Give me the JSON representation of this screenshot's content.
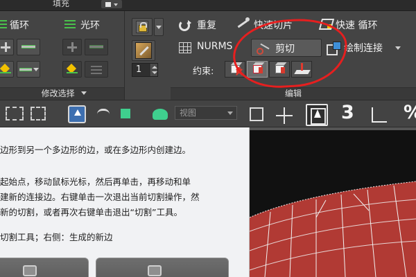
{
  "ribbon": {
    "tab_fill": "填充",
    "left_panel": {
      "loop_label": "循环",
      "ring_label": "光环",
      "spinner_value": "1",
      "footer": "修改选择"
    },
    "edit_panel": {
      "repeat_label": "重复",
      "nurms_label": "NURMS",
      "constraint_label": "约束:",
      "quickslice_label": "快速切片",
      "cut_label": "剪切",
      "swiftloop_label": "快速 循环",
      "paintconnect_label": "绘制连接",
      "spinner_value": "1",
      "footer": "编辑"
    },
    "annotation_color": "#e61f1f"
  },
  "toolbar": {
    "view_combo": "视图",
    "snaps_label": "3",
    "percent_label": "%"
  },
  "help": {
    "line1": "边形到另一个多边形的边，或在多边形内创建边。",
    "line2": "起始点，移动鼠标光标，然后再单击，再移动和单",
    "line3": "建新的连接边。右键单击一次退出当前切割操作，然",
    "line4": "新的切割，或者再次右键单击退出“切割”工具。",
    "line5": "切割工具；右侧：生成的新边"
  },
  "viewport": {
    "mesh_color": "#b13a34"
  }
}
